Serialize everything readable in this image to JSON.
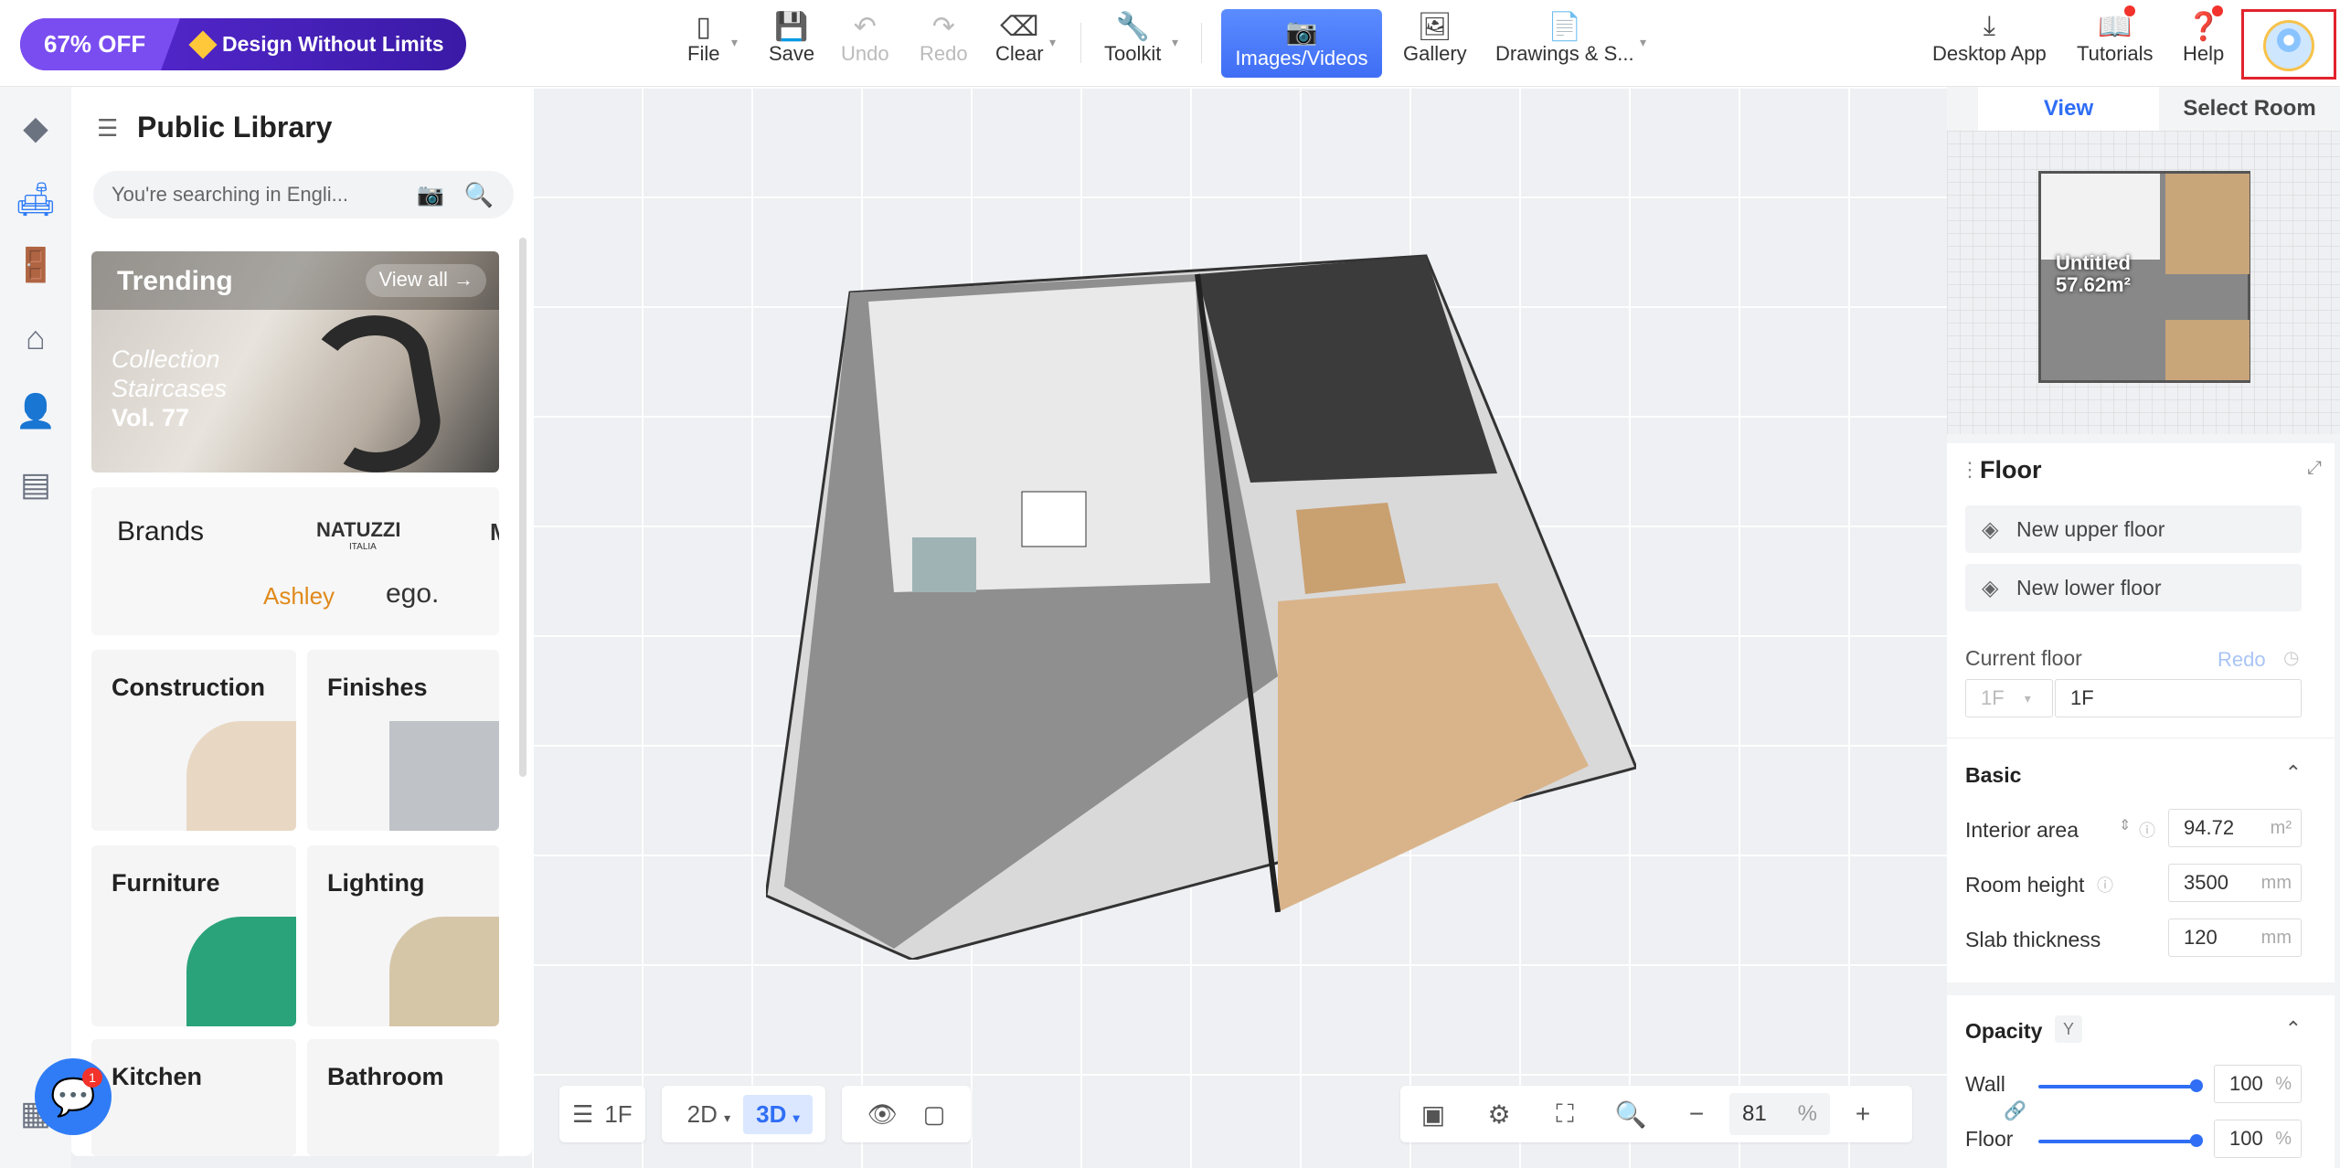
{
  "promo": {
    "discount": "67% OFF",
    "tagline": "Design Without Limits"
  },
  "toolbar": {
    "file": "File",
    "save": "Save",
    "undo": "Undo",
    "redo": "Redo",
    "clear": "Clear",
    "toolkit": "Toolkit",
    "images_videos": "Images/Videos",
    "gallery": "Gallery",
    "drawings": "Drawings & S...",
    "desktop_app": "Desktop App",
    "tutorials": "Tutorials",
    "help": "Help"
  },
  "library": {
    "title": "Public Library",
    "search_placeholder": "You're searching in Engli...",
    "trending": {
      "title": "Trending",
      "view_all": "View all",
      "collection_line1": "Collection",
      "collection_line2": "Staircases",
      "collection_vol": "Vol. 77"
    },
    "brands": {
      "title": "Brands",
      "logos": [
        "NATUZZI",
        "ITALIA",
        "Ashley",
        "ego.",
        "M"
      ]
    },
    "categories": [
      {
        "label": "Construction"
      },
      {
        "label": "Finishes"
      },
      {
        "label": "Furniture"
      },
      {
        "label": "Lighting"
      },
      {
        "label": "Kitchen"
      },
      {
        "label": "Bathroom"
      }
    ]
  },
  "viewport": {
    "floor_label": "1F",
    "mode_2d": "2D",
    "mode_3d": "3D",
    "active_mode": "3D",
    "zoom_value": "81",
    "zoom_unit": "%"
  },
  "right_panel": {
    "tabs": [
      {
        "label": "View"
      },
      {
        "label": "Select Room"
      }
    ],
    "active_tab": "View",
    "minimap_name": "Untitled",
    "minimap_area": "57.62m²",
    "floor_title": "Floor",
    "new_upper_floor": "New upper floor",
    "new_lower_floor": "New lower floor",
    "current_floor_label": "Current floor",
    "redo_label": "Redo",
    "floor_select": "1F",
    "floor_name": "1F",
    "basic_label": "Basic",
    "interior_area_label": "Interior area",
    "interior_area_value": "94.72",
    "interior_area_unit": "m²",
    "room_height_label": "Room height",
    "room_height_value": "3500",
    "room_height_unit": "mm",
    "slab_label": "Slab thickness",
    "slab_value": "120",
    "slab_unit": "mm",
    "opacity_label": "Opacity",
    "opacity_key": "Y",
    "wall_label": "Wall",
    "wall_value": "100",
    "wall_unit": "%",
    "wall_level": 1.0,
    "floor_opacity_label": "Floor",
    "floor_value": "100",
    "floor_unit": "%",
    "floor_level": 1.0
  },
  "chat": {
    "badge": "1"
  },
  "colors": {
    "accent": "#2f6ef5",
    "promo": "#5b2bd8",
    "alert": "#f2322b"
  }
}
